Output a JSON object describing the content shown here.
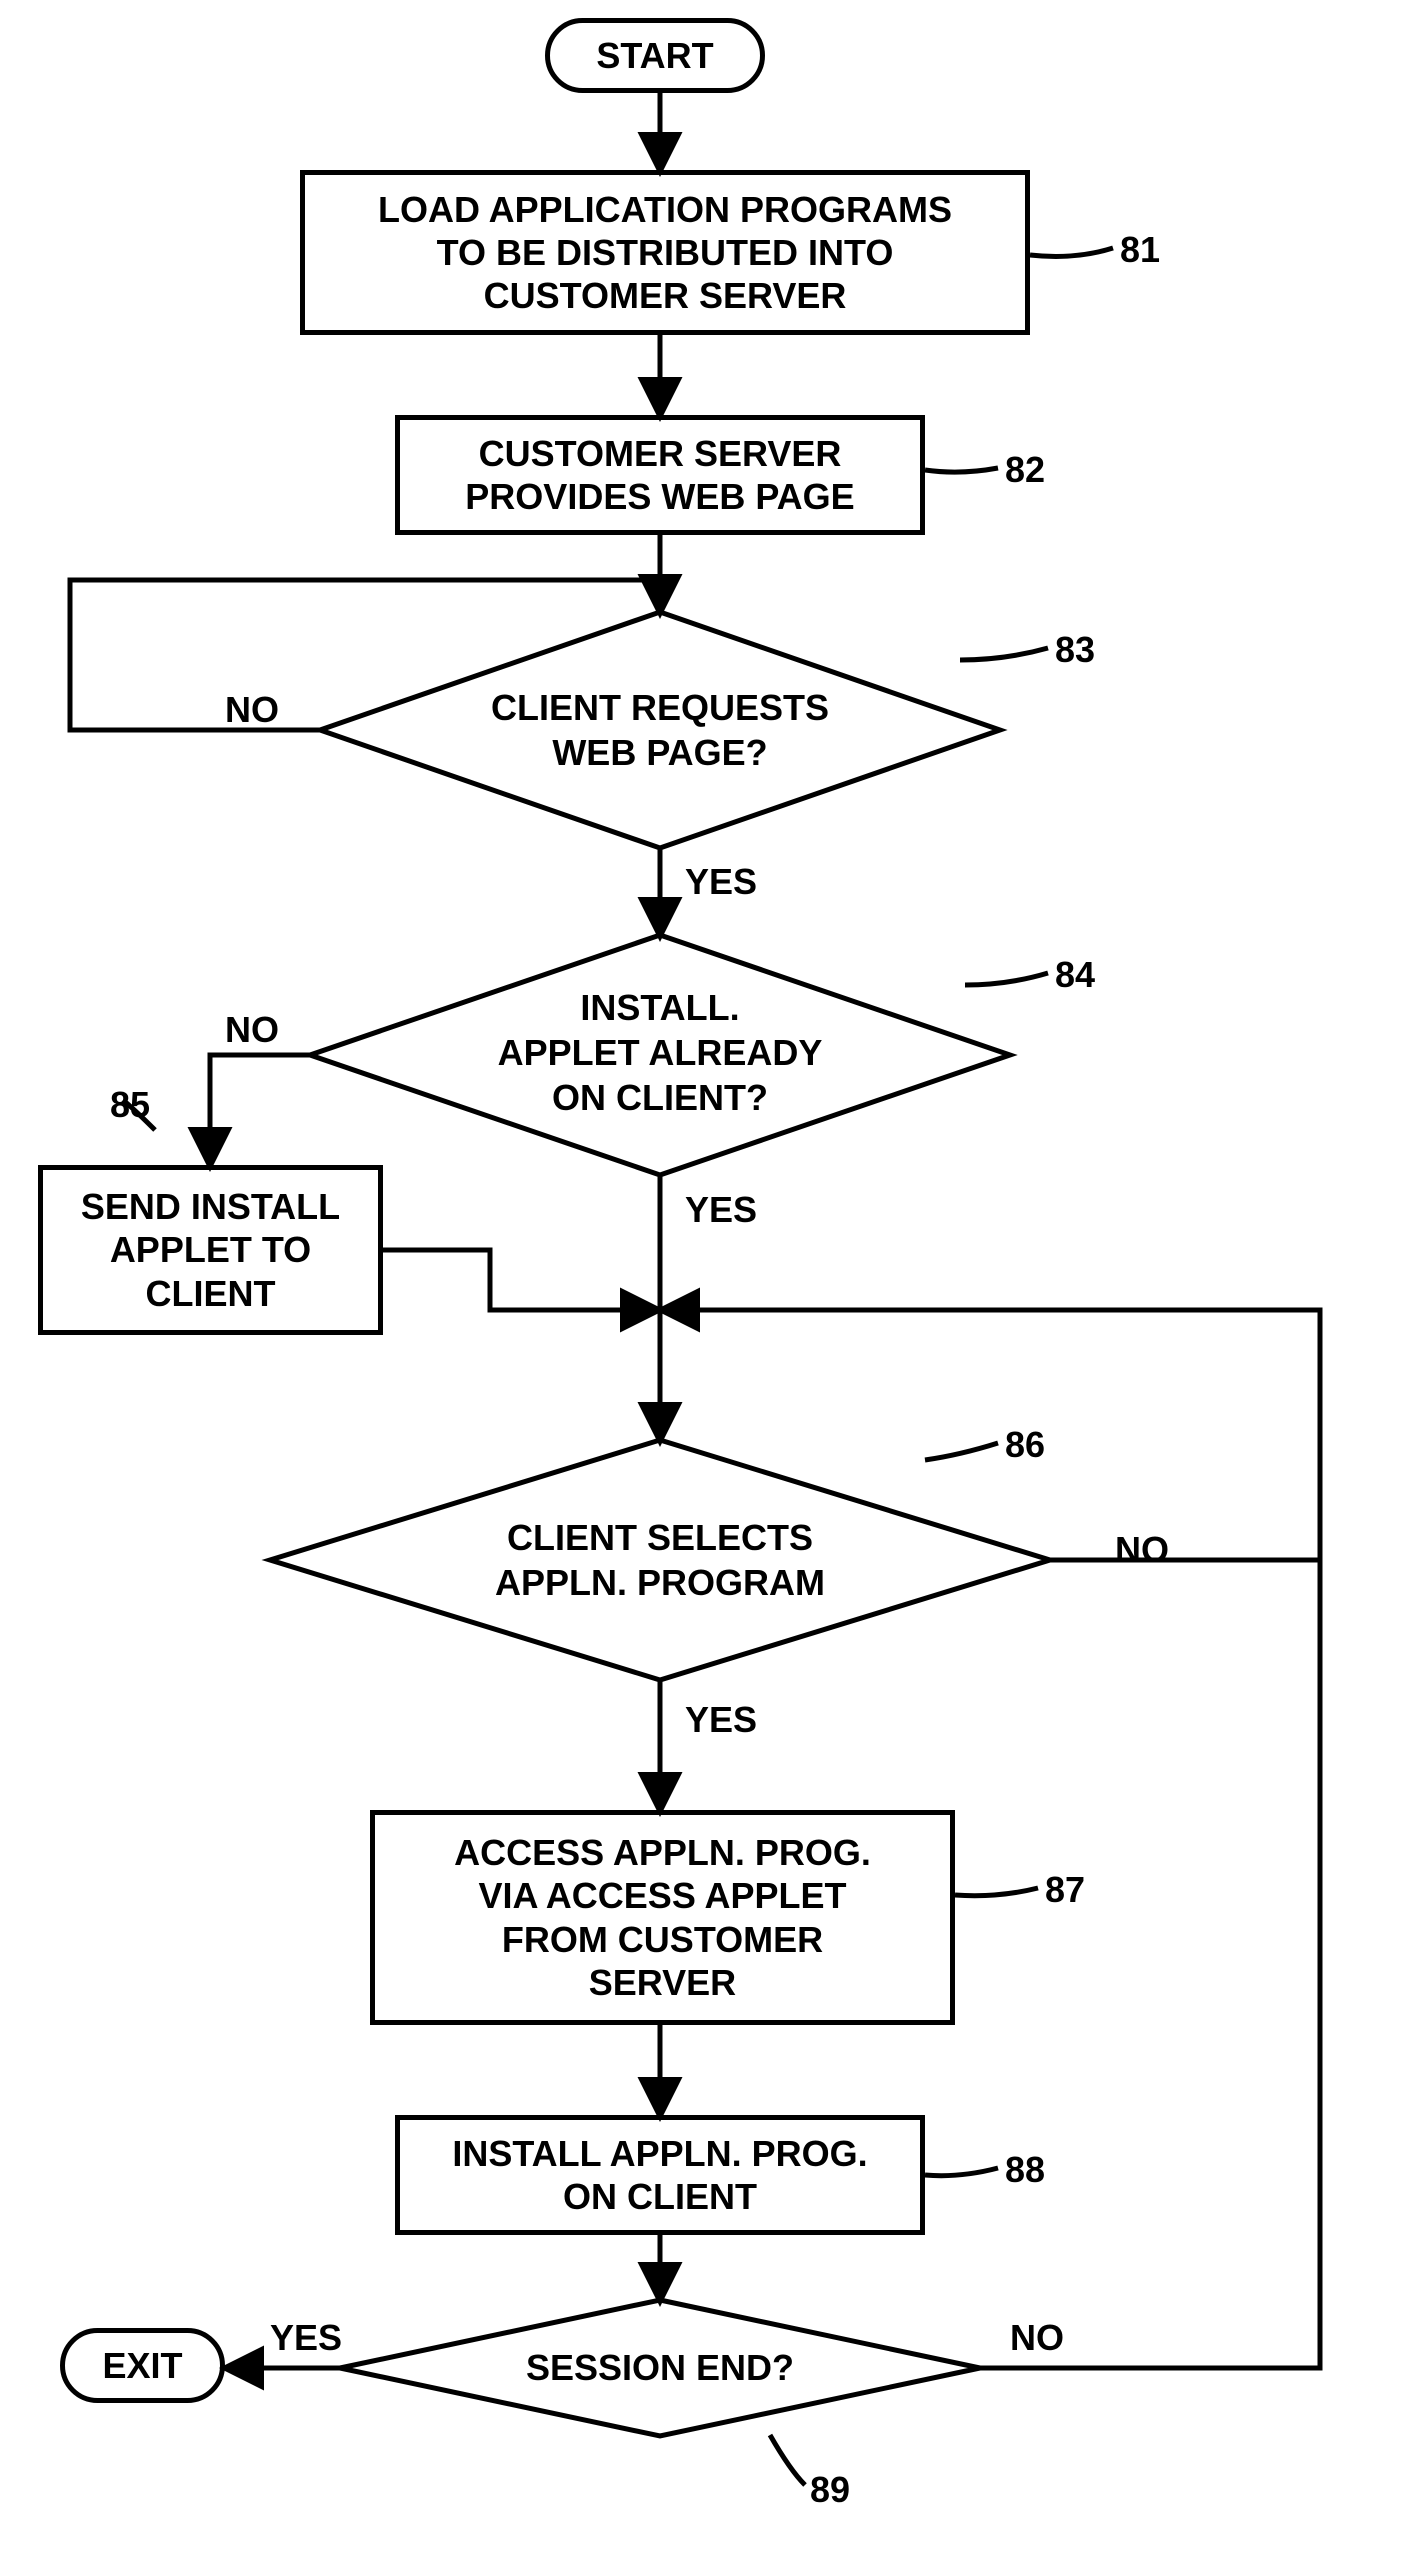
{
  "nodes": {
    "start": "START",
    "n81": "LOAD APPLICATION PROGRAMS\nTO BE DISTRIBUTED INTO\nCUSTOMER SERVER",
    "n82": "CUSTOMER SERVER\nPROVIDES WEB PAGE",
    "n83": "CLIENT REQUESTS\nWEB PAGE?",
    "n84": "INSTALL.\nAPPLET ALREADY\nON CLIENT?",
    "n85": "SEND INSTALL\nAPPLET TO\nCLIENT",
    "n86": "CLIENT SELECTS\nAPPLN. PROGRAM",
    "n87": "ACCESS APPLN. PROG.\nVIA ACCESS APPLET\nFROM CUSTOMER\nSERVER",
    "n88": "INSTALL APPLN. PROG.\nON CLIENT",
    "n89": "SESSION END?",
    "exit": "EXIT"
  },
  "refs": {
    "r81": "81",
    "r82": "82",
    "r83": "83",
    "r84": "84",
    "r85": "85",
    "r86": "86",
    "r87": "87",
    "r88": "88",
    "r89": "89"
  },
  "labels": {
    "yes": "YES",
    "no": "NO"
  }
}
